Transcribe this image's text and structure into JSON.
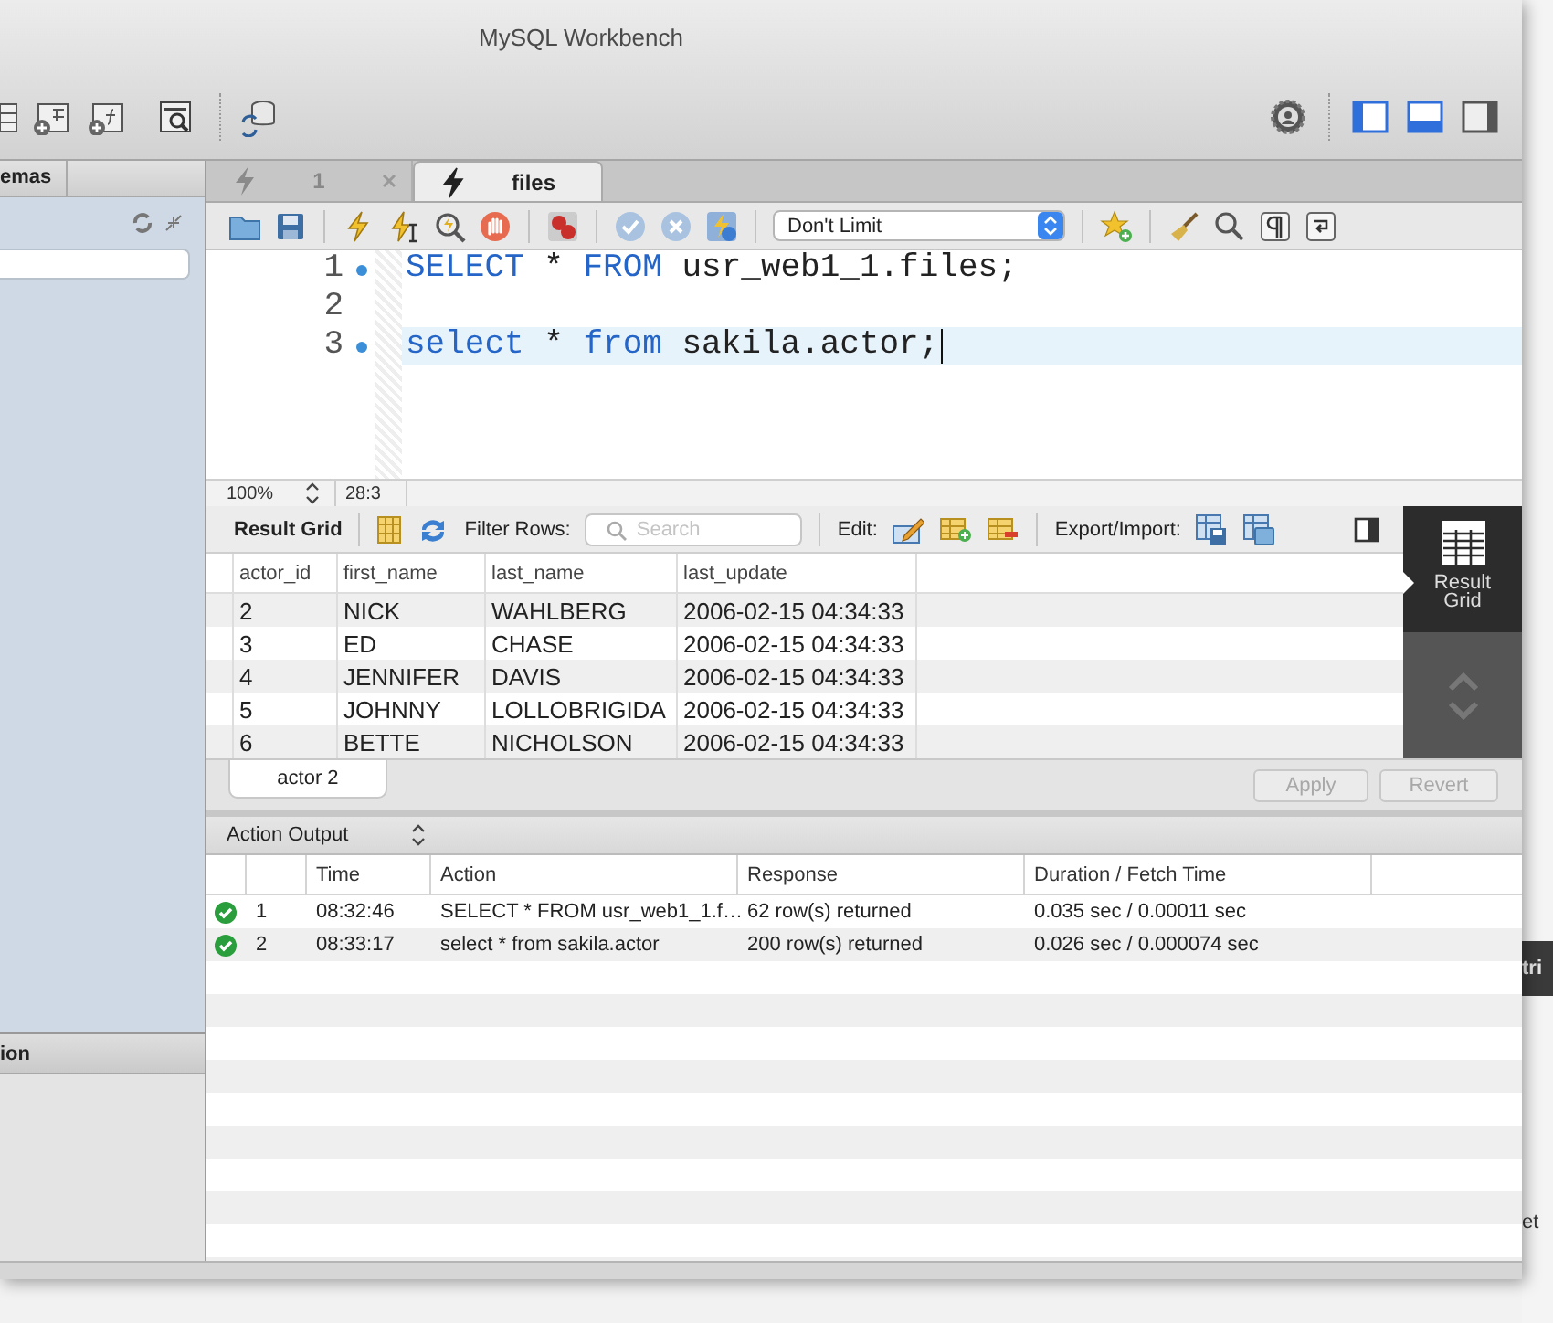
{
  "window": {
    "title": "MySQL Workbench"
  },
  "sidebar": {
    "tab": "emas",
    "bottom_tab": "ion"
  },
  "query_tabs": [
    {
      "label": "1",
      "selected": false
    },
    {
      "label": "files",
      "selected": true
    }
  ],
  "query_toolbar": {
    "limit": "Don't Limit"
  },
  "editor": {
    "lines": [
      {
        "number": "1",
        "marker": true,
        "current": false,
        "tokens": [
          {
            "text": "SELECT",
            "kind": "keyword"
          },
          {
            "text": " * ",
            "kind": "plain"
          },
          {
            "text": "FROM",
            "kind": "keyword"
          },
          {
            "text": " usr_web1_1.files;",
            "kind": "plain"
          }
        ]
      },
      {
        "number": "2",
        "marker": false,
        "current": false
      },
      {
        "number": "3",
        "marker": true,
        "current": true,
        "tokens": [
          {
            "text": "select",
            "kind": "keyword"
          },
          {
            "text": " * ",
            "kind": "plain"
          },
          {
            "text": "from",
            "kind": "keyword"
          },
          {
            "text": " sakila.actor;",
            "kind": "plain"
          }
        ]
      }
    ]
  },
  "editor_status": {
    "zoom": "100%",
    "position": "28:3"
  },
  "result_toolbar": {
    "title": "Result Grid",
    "filter_label": "Filter Rows:",
    "search_placeholder": "Search",
    "edit_label": "Edit:",
    "export_label": "Export/Import:"
  },
  "grid": {
    "columns": [
      "actor_id",
      "first_name",
      "last_name",
      "last_update"
    ],
    "rows": [
      [
        "2",
        "NICK",
        "WAHLBERG",
        "2006-02-15 04:34:33"
      ],
      [
        "3",
        "ED",
        "CHASE",
        "2006-02-15 04:34:33"
      ],
      [
        "4",
        "JENNIFER",
        "DAVIS",
        "2006-02-15 04:34:33"
      ],
      [
        "5",
        "JOHNNY",
        "LOLLOBRIGIDA",
        "2006-02-15 04:34:33"
      ],
      [
        "6",
        "BETTE",
        "NICHOLSON",
        "2006-02-15 04:34:33"
      ]
    ]
  },
  "side_panel": [
    {
      "label": "Result Grid",
      "selected": true
    }
  ],
  "result_tabs": [
    {
      "label": "actor 2",
      "selected": true
    }
  ],
  "result_buttons": [
    {
      "label": "Apply",
      "disabled": true
    },
    {
      "label": "Revert",
      "disabled": true
    }
  ],
  "output": {
    "title": "Action Output",
    "columns": [
      "Time",
      "Action",
      "Response",
      "Duration / Fetch Time"
    ],
    "rows": [
      {
        "succeeded": true,
        "number": "1",
        "time": "08:32:46",
        "action": "SELECT * FROM usr_web1_1.f…",
        "response": "62 row(s) returned",
        "duration": "0.035 sec / 0.00011 sec"
      },
      {
        "succeeded": true,
        "number": "2",
        "time": "08:33:17",
        "action": "select * from sakila.actor",
        "response": "200 row(s) returned",
        "duration": "0.026 sec / 0.000074 sec"
      }
    ]
  },
  "backdrop": {
    "texts": [
      "tri",
      "et"
    ]
  }
}
